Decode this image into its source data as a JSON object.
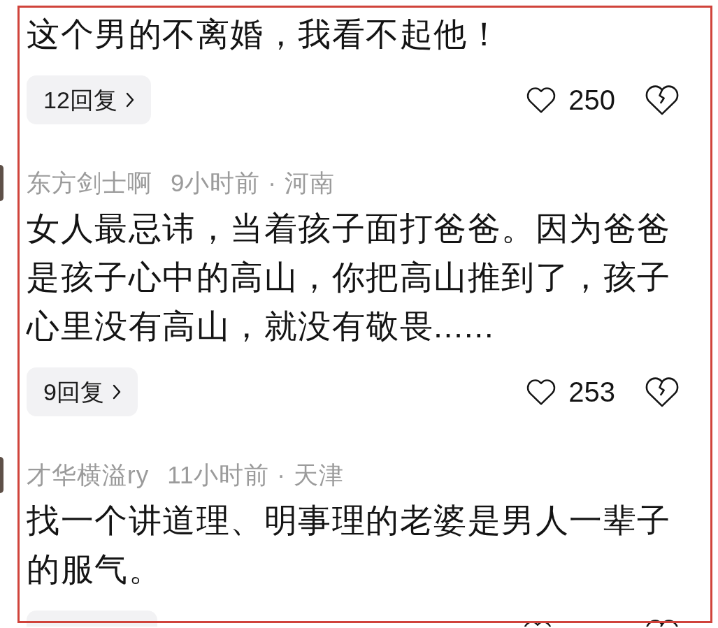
{
  "comments": [
    {
      "body": "这个男的不离婚，我看不起他！",
      "actions": {
        "kind": "full",
        "replies": "12回复",
        "likes": "250"
      }
    },
    {
      "author": "东方剑士啊",
      "info": "9小时前 · 河南",
      "body": "女人最忌讳，当着孩子面打爸爸。因为爸爸是孩子心中的高山，你把高山推到了，孩子心里没有高山，就没有敬畏......",
      "actions": {
        "kind": "full",
        "replies": "9回复",
        "likes": "253"
      }
    },
    {
      "author": "才华横溢ry",
      "info": "11小时前 · 天津",
      "body": "找一个讲道理、明事理的老婆是男人一辈子的服气。",
      "actions": {
        "kind": "clipped"
      }
    }
  ]
}
